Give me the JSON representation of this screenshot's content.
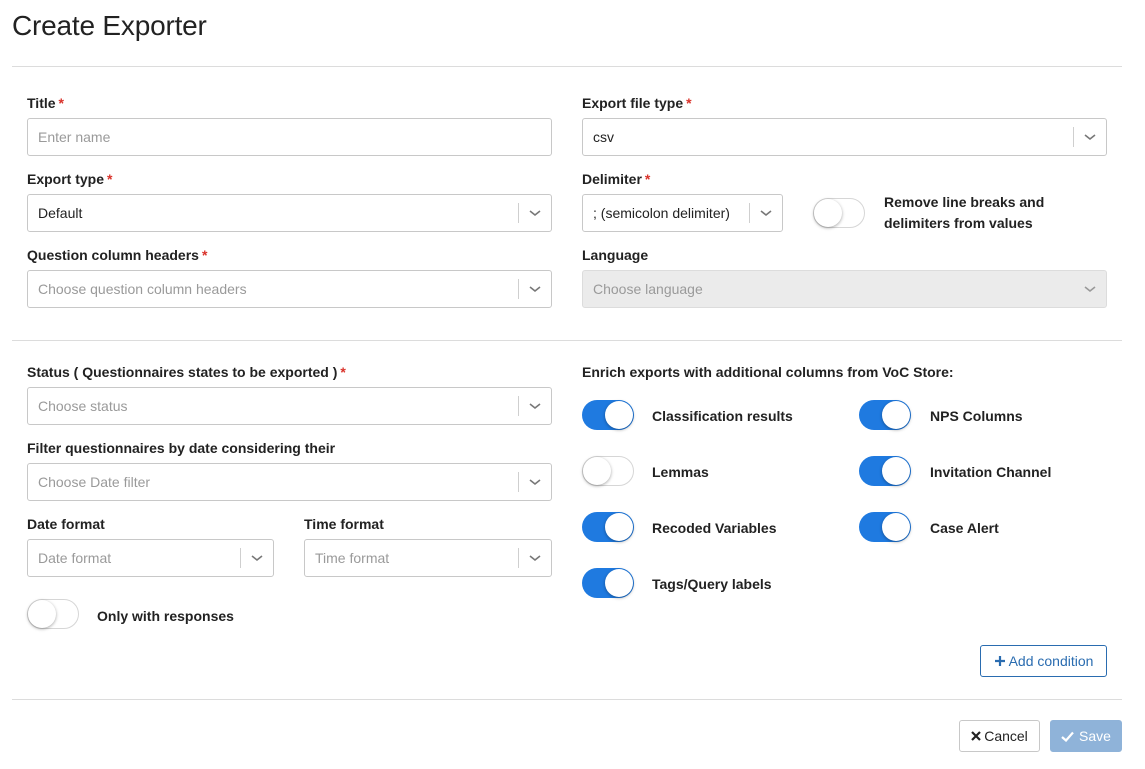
{
  "page": {
    "title": "Create Exporter"
  },
  "title_field": {
    "label": "Title",
    "placeholder": "Enter name",
    "value": ""
  },
  "export_file_type": {
    "label": "Export file type",
    "value": "csv"
  },
  "export_type": {
    "label": "Export type",
    "value": "Default"
  },
  "delimiter": {
    "label": "Delimiter",
    "value": "; (semicolon delimiter)"
  },
  "remove_line_breaks": {
    "label": "Remove line breaks and delimiters from values",
    "on": false
  },
  "question_column_headers": {
    "label": "Question column headers",
    "placeholder": "Choose question column headers"
  },
  "language": {
    "label": "Language",
    "placeholder": "Choose language",
    "disabled": true
  },
  "status": {
    "label": "Status ( Questionnaires states to be exported )",
    "placeholder": "Choose status"
  },
  "date_filter": {
    "label": "Filter questionnaires by date considering their",
    "placeholder": "Choose Date filter"
  },
  "date_format": {
    "label": "Date format",
    "placeholder": "Date format"
  },
  "time_format": {
    "label": "Time format",
    "placeholder": "Time format"
  },
  "only_with_responses": {
    "label": "Only with responses",
    "on": false
  },
  "enrich": {
    "heading": "Enrich exports with additional columns from VoC Store:",
    "options": [
      {
        "label": "Classification results",
        "on": true
      },
      {
        "label": "NPS Columns",
        "on": true
      },
      {
        "label": "Lemmas",
        "on": false
      },
      {
        "label": "Invitation Channel",
        "on": true
      },
      {
        "label": "Recoded Variables",
        "on": true
      },
      {
        "label": "Case Alert",
        "on": true
      },
      {
        "label": "Tags/Query labels",
        "on": true
      }
    ]
  },
  "buttons": {
    "add_condition": "Add condition",
    "cancel": "Cancel",
    "save": "Save"
  },
  "required_marker": "*",
  "colors": {
    "accent": "#1f7ae0",
    "required": "#d9322a",
    "save_disabled": "#8fb3d9",
    "link": "#2a6cb0"
  },
  "icons": {
    "dropdown": "chevron-down-icon",
    "add": "plus-icon",
    "cancel": "close-icon",
    "save": "check-icon"
  }
}
